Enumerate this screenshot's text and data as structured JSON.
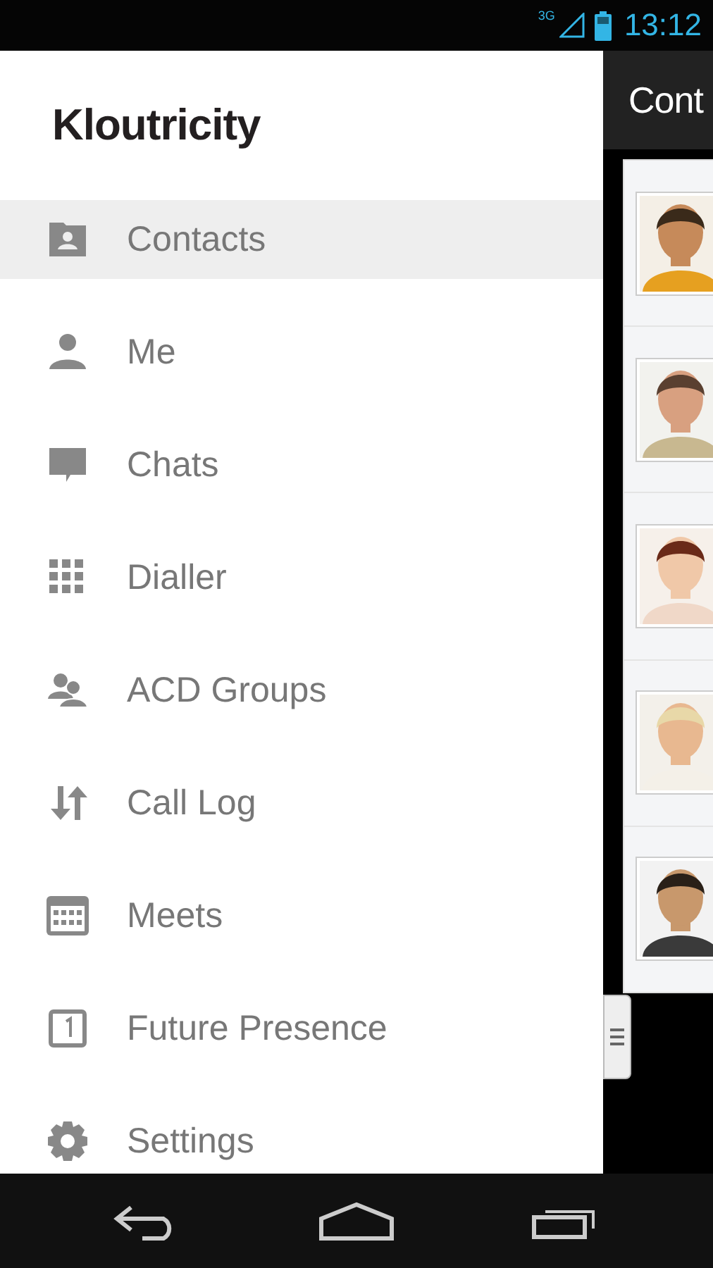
{
  "status_bar": {
    "network": "3G",
    "time": "13:12"
  },
  "drawer": {
    "logo": "Kloutricity",
    "items": [
      {
        "label": "Contacts",
        "selected": true
      },
      {
        "label": "Me",
        "selected": false
      },
      {
        "label": "Chats",
        "selected": false
      },
      {
        "label": "Dialler",
        "selected": false
      },
      {
        "label": "ACD Groups",
        "selected": false
      },
      {
        "label": "Call Log",
        "selected": false
      },
      {
        "label": "Meets",
        "selected": false
      },
      {
        "label": "Future Presence",
        "selected": false
      },
      {
        "label": "Settings",
        "selected": false
      }
    ]
  },
  "main": {
    "title": "Cont"
  }
}
